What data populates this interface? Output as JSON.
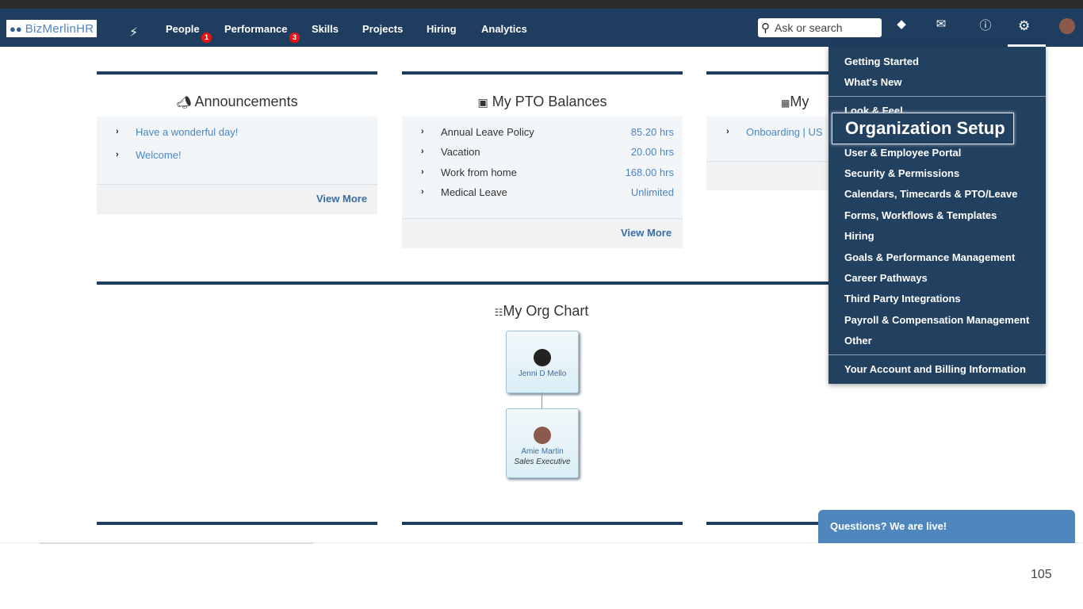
{
  "brand": {
    "name": "BizMerlinHR"
  },
  "nav": {
    "items": [
      {
        "label": "People",
        "badge": "1"
      },
      {
        "label": "Performance",
        "badge": "3"
      },
      {
        "label": "Skills"
      },
      {
        "label": "Projects"
      },
      {
        "label": "Hiring"
      },
      {
        "label": "Analytics"
      }
    ],
    "search_placeholder": "Ask or search"
  },
  "announcements": {
    "title": "Announcements",
    "items": [
      "Have a wonderful day!",
      "Welcome!"
    ],
    "view_more": "View More"
  },
  "pto": {
    "title": "My PTO Balances",
    "items": [
      {
        "label": "Annual Leave Policy",
        "value": "85.20 hrs"
      },
      {
        "label": "Vacation",
        "value": "20.00 hrs"
      },
      {
        "label": "Work from home",
        "value": "168.00 hrs"
      },
      {
        "label": "Medical Leave",
        "value": "Unlimited"
      }
    ],
    "view_more": "View More"
  },
  "third_panel": {
    "title_fragment": "My",
    "item": "Onboarding | US"
  },
  "org_chart": {
    "title": "My Org Chart",
    "manager": {
      "name": "Jenni D Mello"
    },
    "self": {
      "name": "Amie Martin",
      "role": "Sales Executive"
    }
  },
  "settings_menu": {
    "items": [
      "Getting Started",
      "What's New",
      "Look & Feel",
      "Organization Setup",
      "User & Employee Portal",
      "Security & Permissions",
      "Calendars, Timecards & PTO/Leave",
      "Forms, Workflows & Templates",
      "Hiring",
      "Goals & Performance Management",
      "Career Pathways",
      "Third Party Integrations",
      "Payroll & Compensation Management",
      "Other",
      "Your Account and Billing Information"
    ],
    "highlighted": "Organization Setup"
  },
  "chat": {
    "label": "Questions? We are live!"
  },
  "page_number": "105",
  "colors": {
    "navbar": "#1f3d5f",
    "link": "#4a86c5",
    "badge": "#ee1111",
    "chat": "#4f86bd"
  }
}
